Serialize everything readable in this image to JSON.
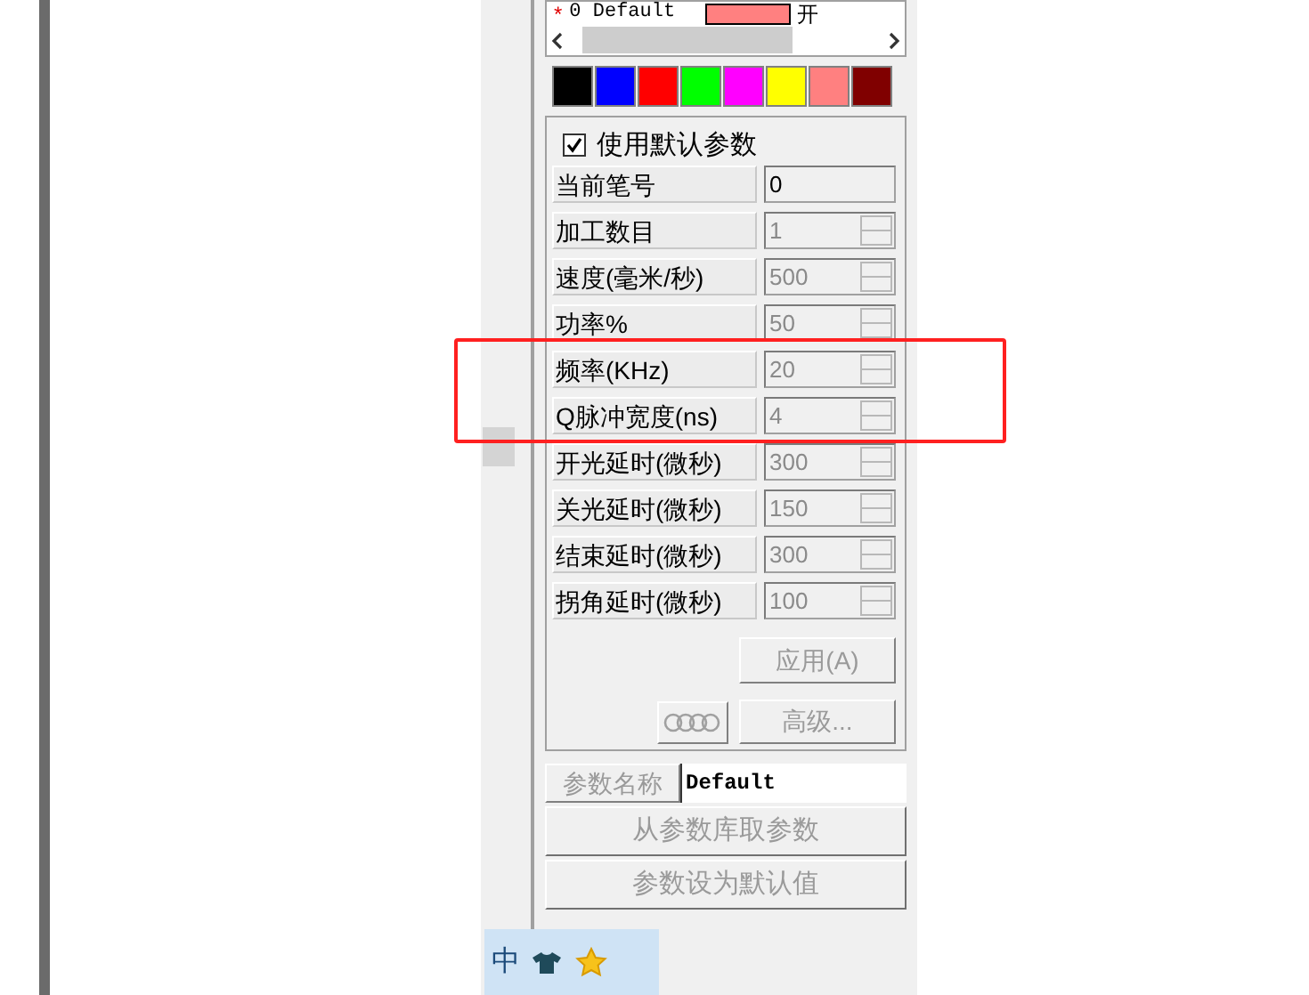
{
  "pen_list": {
    "row": {
      "marker": "*",
      "label": "0 Default",
      "color": "#ff8080",
      "state": "开"
    }
  },
  "palette": [
    {
      "color": "#000000"
    },
    {
      "color": "#0000ff"
    },
    {
      "color": "#ff0000"
    },
    {
      "color": "#00ff00"
    },
    {
      "color": "#ff00ff"
    },
    {
      "color": "#ffff00"
    },
    {
      "color": "#ff8080"
    },
    {
      "color": "#800000"
    }
  ],
  "use_default": {
    "label": "使用默认参数",
    "checked": true
  },
  "params": [
    {
      "label": "当前笔号",
      "value": "0",
      "kind": "plain",
      "disabled": false
    },
    {
      "label": "加工数目",
      "value": "1",
      "kind": "spin",
      "disabled": true
    },
    {
      "label": "速度(毫米/秒)",
      "value": "500",
      "kind": "spin",
      "disabled": true
    },
    {
      "label": "功率%",
      "value": "50",
      "kind": "spin",
      "disabled": true
    },
    {
      "label": "频率(KHz)",
      "value": "20",
      "kind": "spin",
      "disabled": true
    },
    {
      "label": "Q脉冲宽度(ns)",
      "value": "4",
      "kind": "spin",
      "disabled": true
    },
    {
      "label": "开光延时(微秒)",
      "value": "300",
      "kind": "spin",
      "disabled": true
    },
    {
      "label": "关光延时(微秒)",
      "value": "150",
      "kind": "spin",
      "disabled": true
    },
    {
      "label": "结束延时(微秒)",
      "value": "300",
      "kind": "spin",
      "disabled": true
    },
    {
      "label": "拐角延时(微秒)",
      "value": "100",
      "kind": "spin",
      "disabled": true
    }
  ],
  "apply_button": "应用(A)",
  "advanced_button": "高级...",
  "param_name": {
    "label": "参数名称",
    "value": "Default"
  },
  "buttons": [
    "从参数库取参数",
    "参数设为默认值"
  ],
  "ime_bar": {
    "mode": "中"
  }
}
